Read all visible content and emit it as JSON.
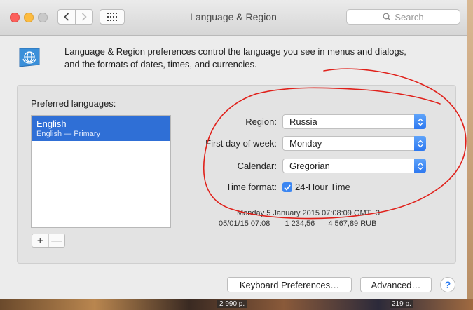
{
  "window": {
    "title": "Language & Region",
    "search_placeholder": "Search"
  },
  "header": {
    "description_line1": "Language & Region preferences control the language you see in menus and dialogs,",
    "description_line2": "and the formats of dates, times, and currencies."
  },
  "languages": {
    "label": "Preferred languages:",
    "items": [
      {
        "name": "English",
        "subtitle": "English — Primary"
      }
    ],
    "add_label": "+",
    "remove_label": "—"
  },
  "form": {
    "region_label": "Region:",
    "region_value": "Russia",
    "first_day_label": "First day of week:",
    "first_day_value": "Monday",
    "calendar_label": "Calendar:",
    "calendar_value": "Gregorian",
    "time_format_label": "Time format:",
    "time_format_option": "24-Hour Time",
    "time_format_checked": true
  },
  "sample": {
    "long_date": "Monday 5 January 2015 07:08:09 GMT+3",
    "short_date": "05/01/15 07:08",
    "number": "1 234,56",
    "currency": "4 567,89 RUB"
  },
  "footer": {
    "keyboard_button": "Keyboard Preferences…",
    "advanced_button": "Advanced…",
    "help_button": "?"
  },
  "desktop_strip": {
    "price_left": "2 990 р.",
    "price_right": "219 р."
  },
  "colors": {
    "selection_blue": "#2f6fd6",
    "annotation_red": "#e0201a",
    "select_arrow_blue": "#2d78f0"
  }
}
